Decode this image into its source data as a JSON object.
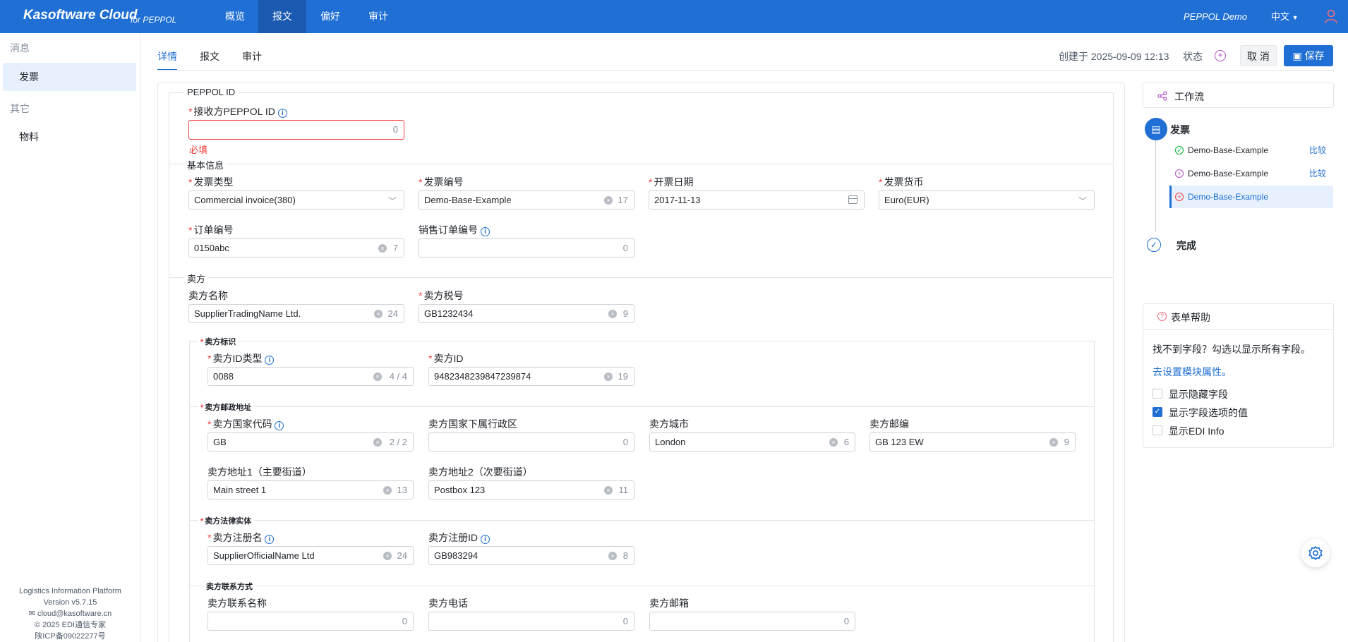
{
  "brand": {
    "name": "Kasoftware Cloud",
    "sub": "for PEPPOL"
  },
  "topnav": [
    "概览",
    "报文",
    "偏好",
    "审计"
  ],
  "top_right": {
    "demo": "PEPPOL Demo",
    "lang": "中文"
  },
  "sidebar": {
    "group1": "消息",
    "item1": "发票",
    "group2": "其它",
    "item2": "物料",
    "footer": {
      "platform": "Logistics Information Platform",
      "version": "Version v5.7.15",
      "email": "cloud@kasoftware.cn",
      "copyright": "© 2025 EDI通信专家",
      "icp": "陕ICP备09022277号"
    }
  },
  "tabs": [
    "详情",
    "报文",
    "审计"
  ],
  "meta": {
    "created": "创建于 2025-09-09 12:13",
    "status_label": "状态"
  },
  "buttons": {
    "cancel": "取 消",
    "save": "保存"
  },
  "sections": {
    "peppol": "PEPPOL ID",
    "basic": "基本信息",
    "seller": "卖方",
    "seller_id": "卖方标识",
    "seller_addr": "卖方邮政地址",
    "seller_legal": "卖方法律实体",
    "seller_contact": "卖方联系方式"
  },
  "fields": {
    "receiver_id": {
      "label": "接收方PEPPOL ID",
      "value": "",
      "count": "0",
      "error": "必填"
    },
    "invoice_type": {
      "label": "发票类型",
      "value": "Commercial invoice(380)"
    },
    "invoice_no": {
      "label": "发票编号",
      "value": "Demo-Base-Example",
      "count": "17"
    },
    "issue_date": {
      "label": "开票日期",
      "value": "2017-11-13"
    },
    "currency": {
      "label": "发票货币",
      "value": "Euro(EUR)"
    },
    "order_no": {
      "label": "订单编号",
      "value": "0150abc",
      "count": "7"
    },
    "sales_order_no": {
      "label": "销售订单编号",
      "value": "",
      "count": "0"
    },
    "seller_name": {
      "label": "卖方名称",
      "value": "SupplierTradingName Ltd.",
      "count": "24"
    },
    "seller_tax": {
      "label": "卖方税号",
      "value": "GB1232434",
      "count": "9"
    },
    "seller_id_type": {
      "label": "卖方ID类型",
      "value": "0088",
      "count": "4 / 4"
    },
    "seller_id": {
      "label": "卖方ID",
      "value": "9482348239847239874",
      "count": "19"
    },
    "country_code": {
      "label": "卖方国家代码",
      "value": "GB",
      "count": "2 / 2"
    },
    "subdivision": {
      "label": "卖方国家下属行政区",
      "value": "",
      "count": "0"
    },
    "city": {
      "label": "卖方城市",
      "value": "London",
      "count": "6"
    },
    "postcode": {
      "label": "卖方邮编",
      "value": "GB 123 EW",
      "count": "9"
    },
    "addr1": {
      "label": "卖方地址1（主要街道）",
      "value": "Main street 1",
      "count": "13"
    },
    "addr2": {
      "label": "卖方地址2（次要街道）",
      "value": "Postbox 123",
      "count": "11"
    },
    "reg_name": {
      "label": "卖方注册名",
      "value": "SupplierOfficialName Ltd",
      "count": "24"
    },
    "reg_id": {
      "label": "卖方注册ID",
      "value": "GB983294",
      "count": "8"
    },
    "contact_name": {
      "label": "卖方联系名称",
      "value": "",
      "count": "0"
    },
    "phone": {
      "label": "卖方电话",
      "value": "",
      "count": "0"
    },
    "email": {
      "label": "卖方邮箱",
      "value": "",
      "count": "0"
    }
  },
  "workflow": {
    "title": "工作流",
    "node": "发票",
    "items": [
      "Demo-Base-Example",
      "Demo-Base-Example",
      "Demo-Base-Example"
    ],
    "compare": "比较",
    "done": "完成"
  },
  "help": {
    "title": "表单帮助",
    "text": "找不到字段？勾选以显示所有字段。",
    "link": "去设置模块属性。",
    "options": [
      "显示隐藏字段",
      "显示字段选项的值",
      "显示EDI Info"
    ]
  },
  "colors": {
    "primary": "#1f6fd4",
    "error": "#f53f3f",
    "nav_active": "#1a5ab0"
  }
}
